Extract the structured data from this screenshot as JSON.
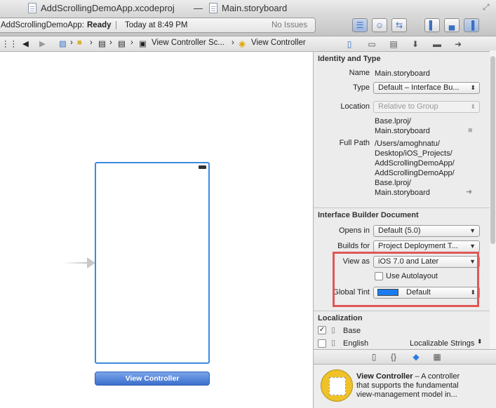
{
  "window": {
    "project_file": "AddScrollingDemoApp.xcodeproj",
    "separator": "—",
    "storyboard_file": "Main.storyboard"
  },
  "toolbar": {
    "status_app": "AddScrollingDemoApp:",
    "status_state": "Ready",
    "status_divider": "|",
    "status_time": "Today at 8:49 PM",
    "status_issues": "No Issues"
  },
  "jumpbar": {
    "scene": "View Controller Sc...",
    "controller": "View Controller"
  },
  "canvas": {
    "view_controller_label": "View Controller"
  },
  "inspector": {
    "identity": {
      "title": "Identity and Type",
      "name_label": "Name",
      "name_value": "Main.storyboard",
      "type_label": "Type",
      "type_value": "Default – Interface Bu...",
      "location_label": "Location",
      "location_value": "Relative to Group",
      "location_path_1": "Base.lproj/",
      "location_path_2": "Main.storyboard",
      "full_path_label": "Full Path",
      "full_path_1": "/Users/amoghnatu/",
      "full_path_2": "Desktop/iOS_Projects/",
      "full_path_3": "AddScrollingDemoApp/",
      "full_path_4": "AddScrollingDemoApp/",
      "full_path_5": "Base.lproj/",
      "full_path_6": "Main.storyboard"
    },
    "ib_document": {
      "title": "Interface Builder Document",
      "opens_in_label": "Opens in",
      "opens_in_value": "Default (5.0)",
      "builds_for_label": "Builds for",
      "builds_for_value": "Project Deployment T...",
      "view_as_label": "View as",
      "view_as_value": "iOS 7.0 and Later",
      "use_autolayout_label": "Use Autolayout",
      "use_autolayout_checked": false,
      "global_tint_label": "Global Tint",
      "global_tint_value": "Default",
      "global_tint_color": "#1a7cf0"
    },
    "localization": {
      "title": "Localization",
      "items": [
        {
          "name": "Base",
          "checked": true
        },
        {
          "name": "English",
          "checked": false
        }
      ],
      "english_mode": "Localizable Strings"
    }
  },
  "library": {
    "item_title": "View Controller",
    "item_desc_1": "– A controller",
    "item_desc_2": "that supports the fundamental",
    "item_desc_3": "view-management model in..."
  },
  "colors": {
    "selection_border": "#3d8ae0",
    "highlight_box": "#e05757"
  }
}
